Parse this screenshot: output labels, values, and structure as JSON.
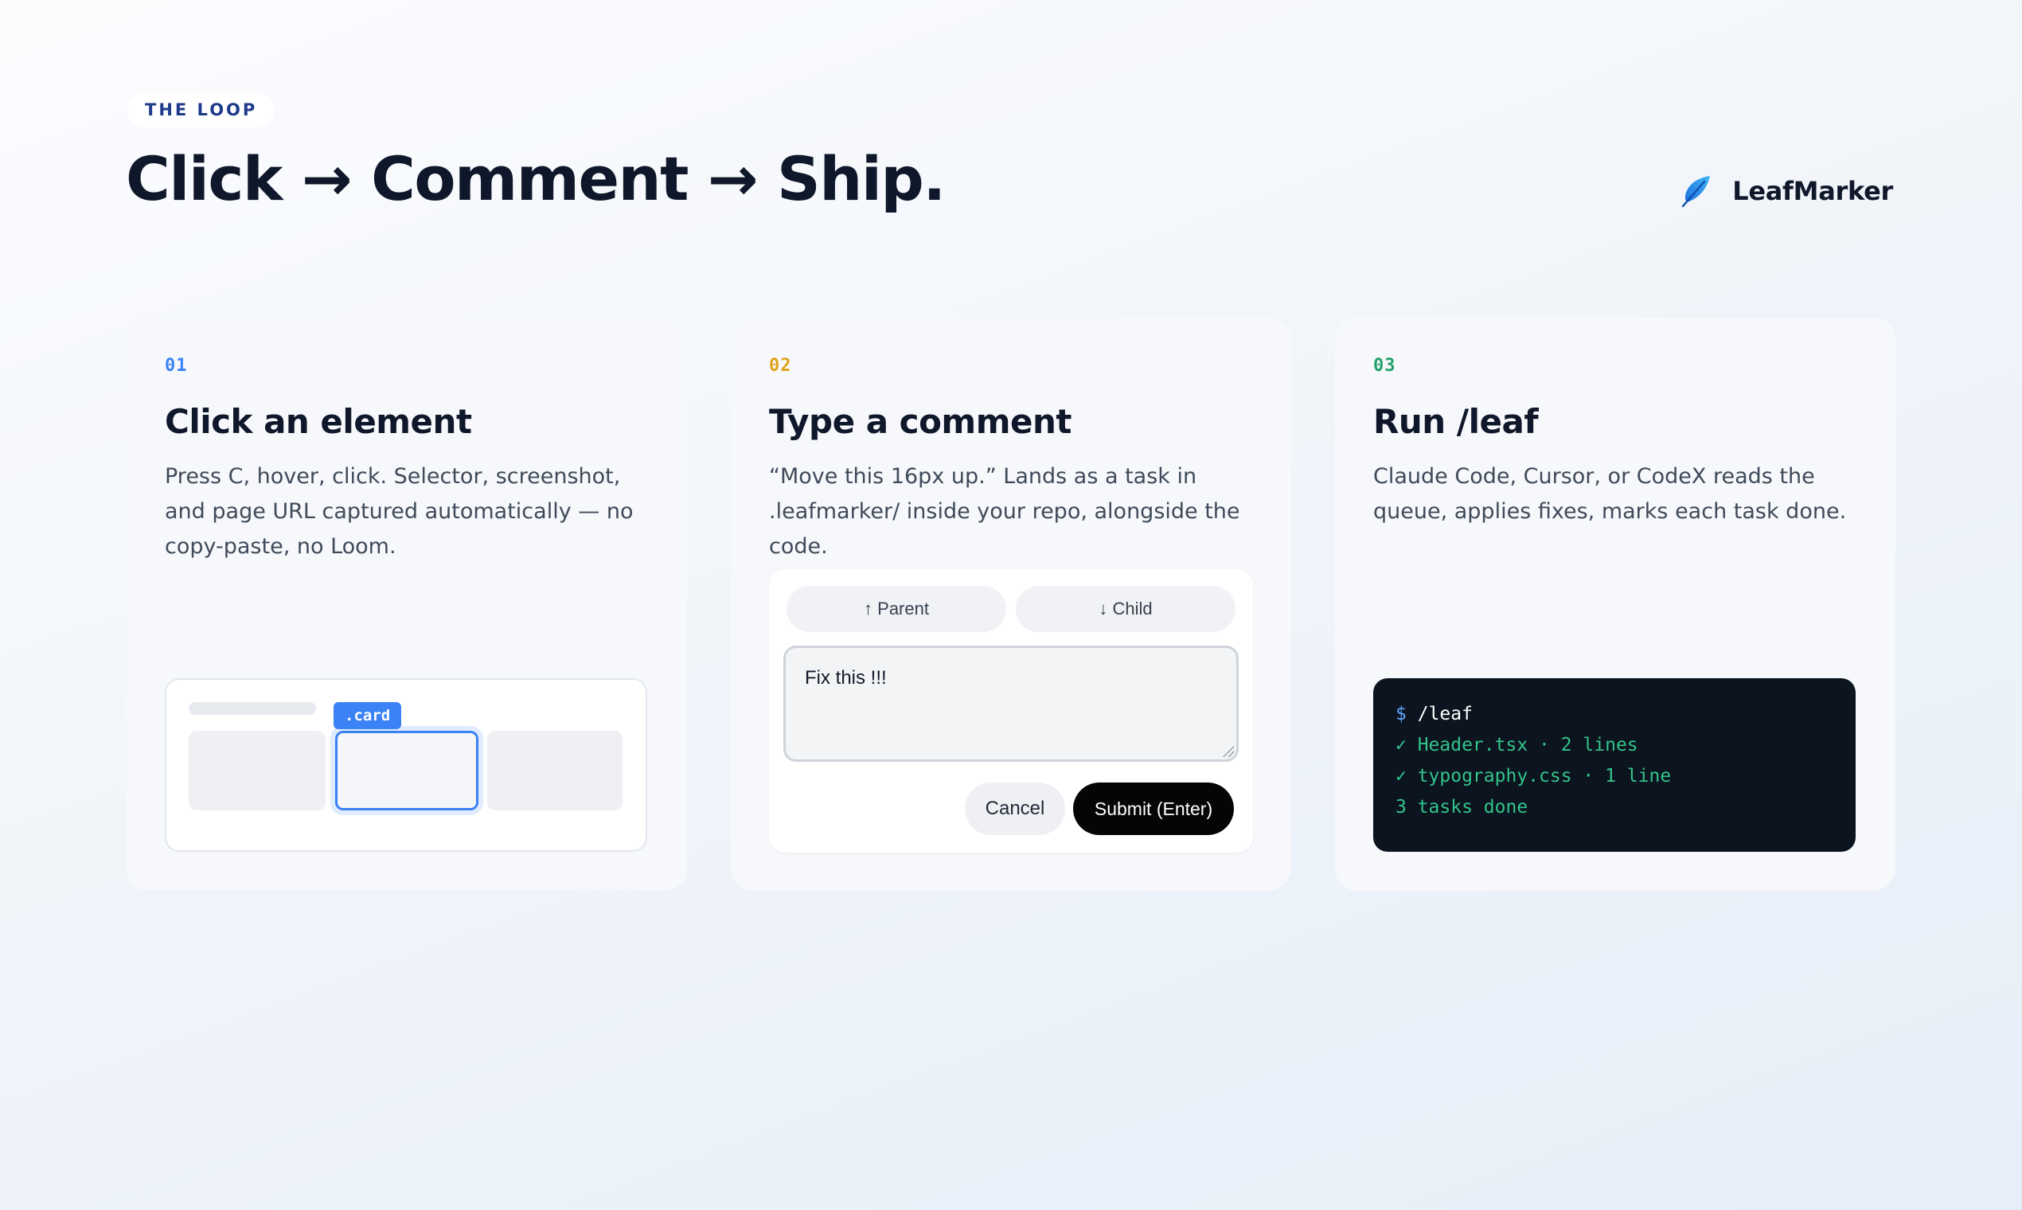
{
  "header": {
    "eyebrow": "THE LOOP",
    "title": "Click → Comment → Ship.",
    "brand_name": "LeafMarker",
    "brand_icon": "feather-leaf-icon"
  },
  "colors": {
    "step1": "#3b82f6",
    "step2": "#e0a21a",
    "step3": "#22a06b",
    "terminal_bg": "#0b141f",
    "terminal_green": "#34c48a"
  },
  "steps": [
    {
      "number": "01",
      "title": "Click an element",
      "description": "Press C, hover, click. Selector, screenshot, and page URL captured automatically — no copy-paste, no Loom.",
      "mock": {
        "selector_tag": ".card"
      }
    },
    {
      "number": "02",
      "title": "Type a comment",
      "description": "“Move this 16px up.” Lands as a task in .leafmarker/ inside your repo, alongside the code.",
      "mock": {
        "parent_label": "↑ Parent",
        "child_label": "↓ Child",
        "comment_value": "Fix this !!!",
        "cancel_label": "Cancel",
        "submit_label": "Submit (Enter)"
      }
    },
    {
      "number": "03",
      "title": "Run /leaf",
      "description": "Claude Code, Cursor, or CodeX reads the queue, applies fixes, marks each task done.",
      "terminal": {
        "prompt": "$",
        "command": "/leaf",
        "lines": [
          "✓ Header.tsx · 2 lines",
          "✓ typography.css · 1 line",
          "3 tasks done"
        ]
      }
    }
  ]
}
